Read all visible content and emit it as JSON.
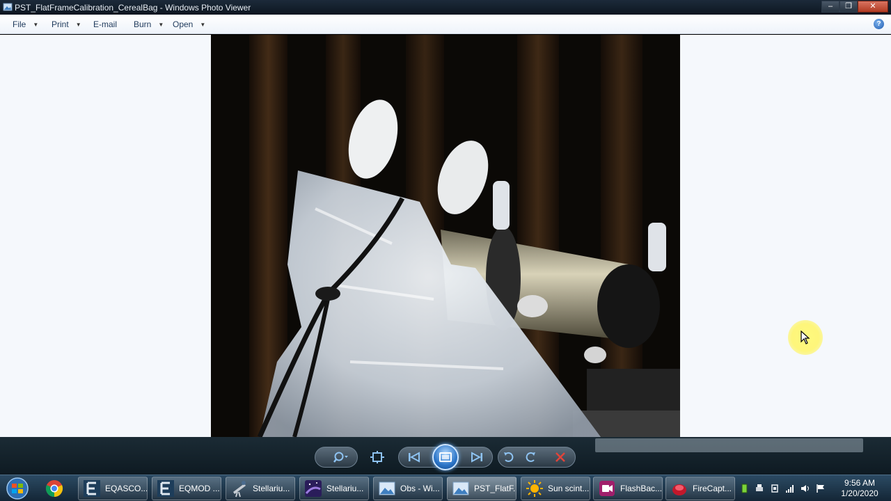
{
  "window": {
    "title": "PST_FlatFrameCalibration_CerealBag - Windows Photo Viewer",
    "buttons": {
      "minimize": "–",
      "restore": "❐",
      "close": "✕"
    }
  },
  "menu": {
    "items": [
      {
        "label": "File",
        "has_dropdown": true
      },
      {
        "label": "Print",
        "has_dropdown": true
      },
      {
        "label": "E-mail",
        "has_dropdown": false
      },
      {
        "label": "Burn",
        "has_dropdown": true
      },
      {
        "label": "Open",
        "has_dropdown": true
      }
    ],
    "help": "?"
  },
  "controls": {
    "icons": [
      "zoom-icon",
      "actual-size-icon",
      "previous-icon",
      "slideshow-icon",
      "next-icon",
      "rotate-counterclockwise-icon",
      "rotate-clockwise-icon",
      "delete-icon"
    ]
  },
  "taskbar": {
    "items": [
      {
        "label": "",
        "icon": "chrome-icon"
      },
      {
        "label": "EQASCO...",
        "icon": "eqasco-icon"
      },
      {
        "label": "EQMOD ...",
        "icon": "eqmod-icon"
      },
      {
        "label": "Stellariu...",
        "icon": "stellarium-scope-icon"
      },
      {
        "label": "Stellariu...",
        "icon": "stellarium-icon"
      },
      {
        "label": "Obs - Wi...",
        "icon": "photo-icon"
      },
      {
        "label": "PST_FlatF...",
        "icon": "photo-viewer-icon"
      },
      {
        "label": "Sun scint...",
        "icon": "sun-icon"
      },
      {
        "label": "FlashBac...",
        "icon": "flashback-icon"
      },
      {
        "label": "FireCapt...",
        "icon": "firecapture-icon"
      }
    ],
    "clock": {
      "time": "9:56 AM",
      "date": "1/20/2020"
    }
  },
  "colors": {
    "viewer_bg": "#f5f8fc",
    "taskbar": "#1f3a52",
    "cursor_highlight": "#fff36a"
  }
}
